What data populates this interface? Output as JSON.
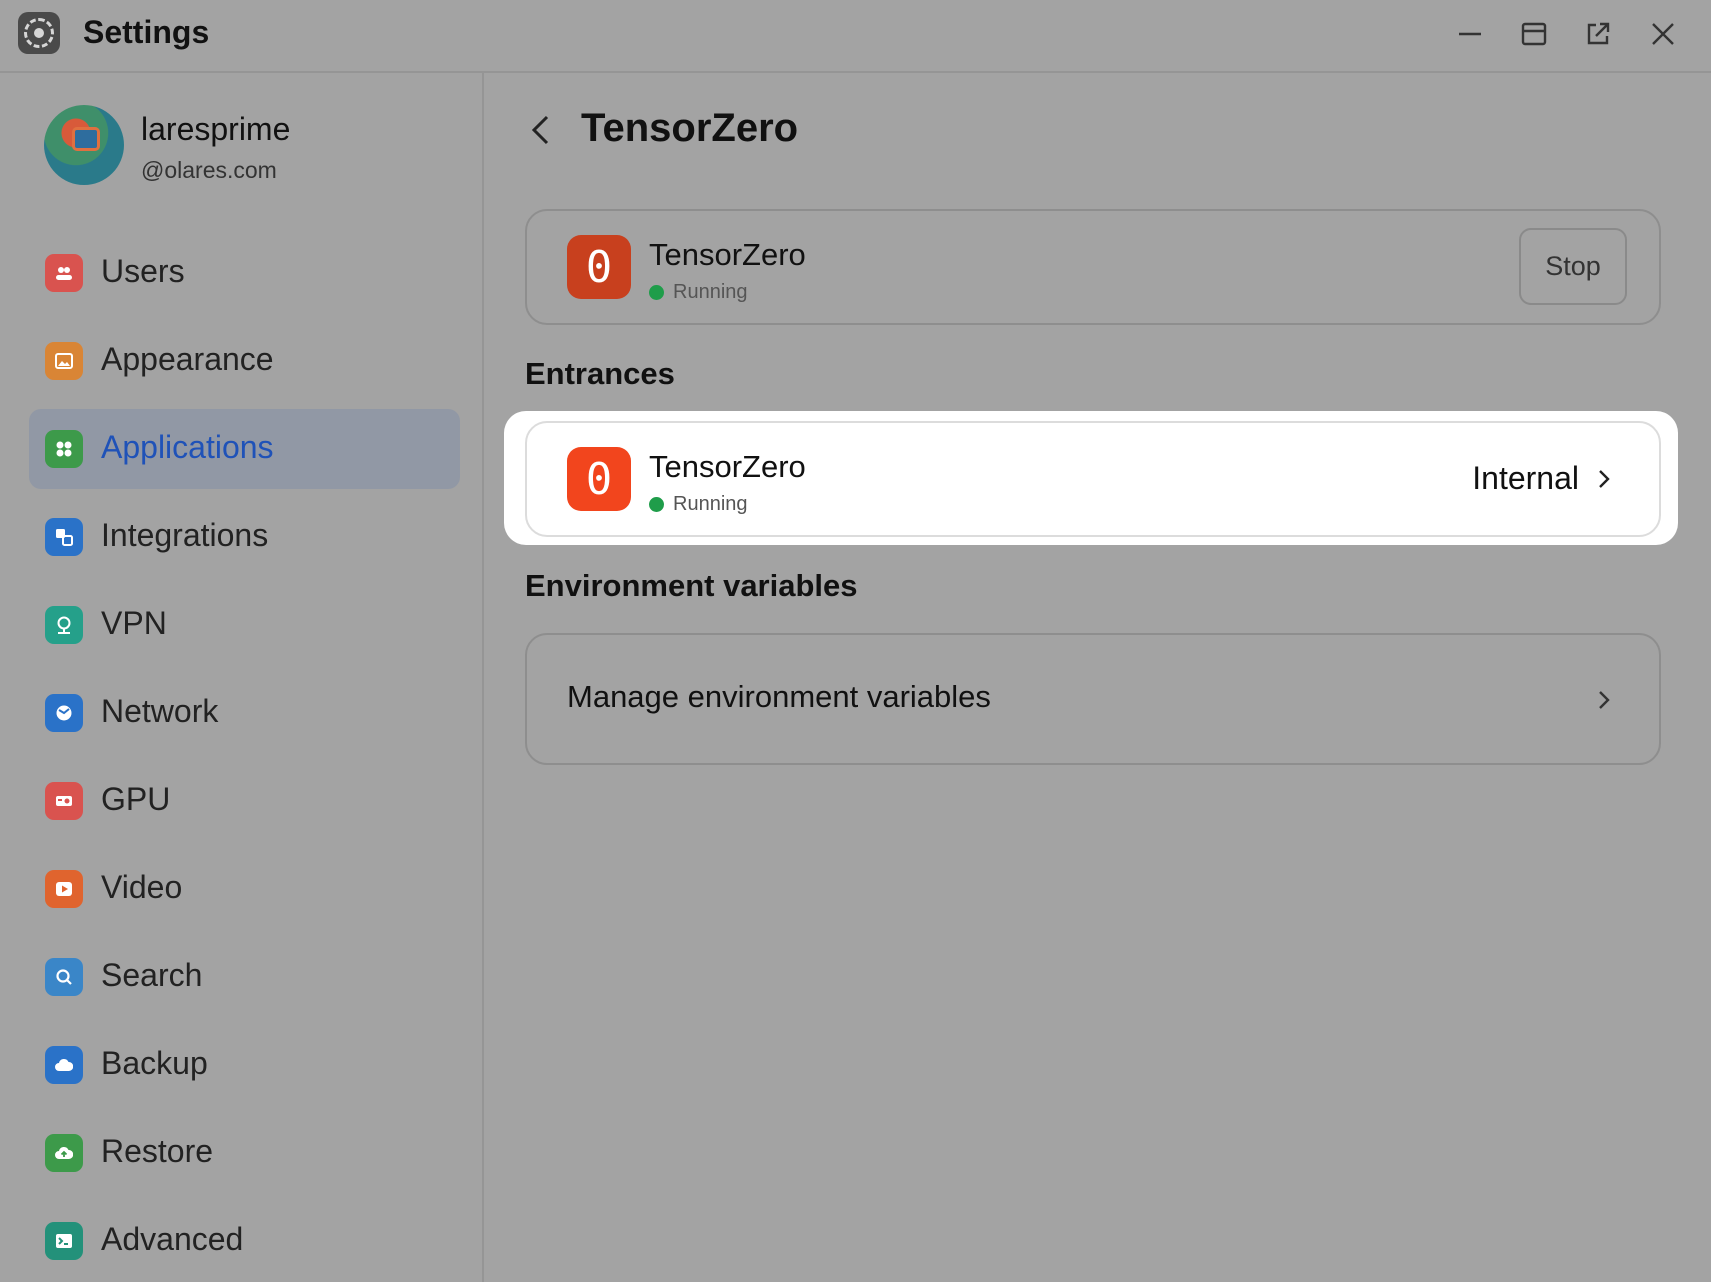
{
  "window": {
    "title": "Settings",
    "controls": [
      "minimize-icon",
      "maximize-icon",
      "open-external-icon",
      "close-icon"
    ]
  },
  "profile": {
    "name": "laresprime",
    "domain": "@olares.com"
  },
  "sidebar": {
    "items": [
      {
        "label": "Users",
        "icon": "users-icon",
        "color": "#d9534f"
      },
      {
        "label": "Appearance",
        "icon": "image-icon",
        "color": "#d98535"
      },
      {
        "label": "Applications",
        "icon": "apps-icon",
        "color": "#3d9a4a",
        "active": true
      },
      {
        "label": "Integrations",
        "icon": "integrations-icon",
        "color": "#2a72c8"
      },
      {
        "label": "VPN",
        "icon": "vpn-icon",
        "color": "#25a08a"
      },
      {
        "label": "Network",
        "icon": "network-icon",
        "color": "#2a72c8"
      },
      {
        "label": "GPU",
        "icon": "gpu-icon",
        "color": "#d9534f"
      },
      {
        "label": "Video",
        "icon": "video-icon",
        "color": "#e0642e"
      },
      {
        "label": "Search",
        "icon": "search-icon",
        "color": "#3a86c8"
      },
      {
        "label": "Backup",
        "icon": "cloud-icon",
        "color": "#2a72c8"
      },
      {
        "label": "Restore",
        "icon": "restore-icon",
        "color": "#3d9a4a"
      },
      {
        "label": "Advanced",
        "icon": "terminal-icon",
        "color": "#23917a"
      }
    ],
    "active_color": "#1f52b8"
  },
  "main": {
    "title": "TensorZero",
    "app": {
      "name": "TensorZero",
      "status": "Running",
      "stop_label": "Stop",
      "icon_glyph": "0",
      "icon_color": "#c8401e"
    },
    "entrances": {
      "heading": "Entrances",
      "item": {
        "name": "TensorZero",
        "status": "Running",
        "access": "Internal",
        "icon_glyph": "0",
        "icon_color": "#f2451d"
      }
    },
    "env": {
      "heading": "Environment variables",
      "manage_label": "Manage environment variables"
    },
    "status_color": "#1f9d4a"
  }
}
